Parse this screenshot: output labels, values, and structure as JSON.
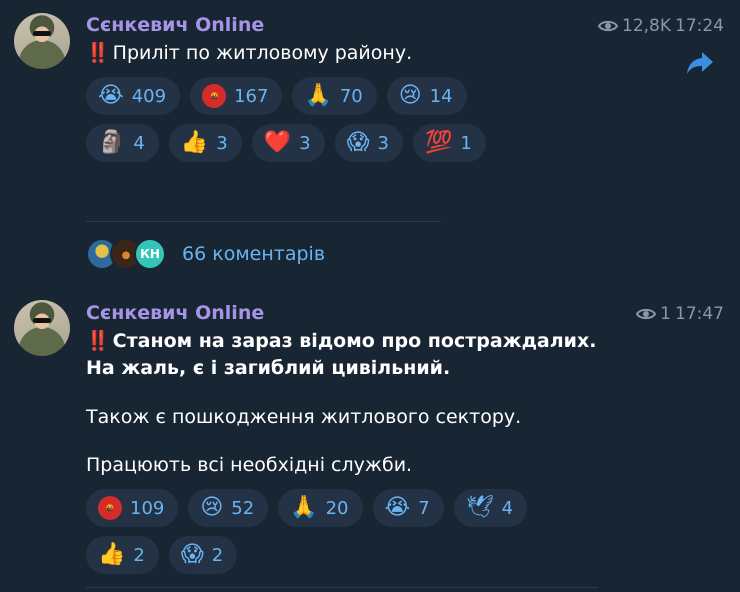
{
  "posts": [
    {
      "author": "Сєнкевич Online",
      "views": "12,8K",
      "time": "17:24",
      "alert": "‼️",
      "text": "Приліт по житловому району.",
      "reactions": [
        {
          "emoji": "😭",
          "count": "409"
        },
        {
          "emoji": "🤬",
          "count": "167"
        },
        {
          "emoji": "🙏",
          "count": "70"
        },
        {
          "emoji": "😢",
          "count": "14"
        },
        {
          "emoji": "🗿",
          "count": "4"
        },
        {
          "emoji": "👍",
          "count": "3"
        },
        {
          "emoji": "❤️",
          "count": "3"
        },
        {
          "emoji": "😱",
          "count": "3"
        },
        {
          "emoji": "💯",
          "count": "1"
        }
      ],
      "comments": {
        "count_label": "66 коментарів",
        "avatar_initials": "КН"
      }
    },
    {
      "author": "Сєнкевич Online",
      "views": "1",
      "time": "17:47",
      "alert": "‼️",
      "text_bold": "Станом на зараз відомо про постраждалих. На жаль, є і загиблий цивільний.",
      "text_line2": "Також є пошкодження житлового сектору.",
      "text_line3": "Працюють всі необхідні служби.",
      "reactions": [
        {
          "emoji": "🤬",
          "count": "109"
        },
        {
          "emoji": "😢",
          "count": "52"
        },
        {
          "emoji": "🙏",
          "count": "20"
        },
        {
          "emoji": "😭",
          "count": "7"
        },
        {
          "emoji": "🕊",
          "count": "4"
        },
        {
          "emoji": "👍",
          "count": "2"
        },
        {
          "emoji": "😱",
          "count": "2"
        }
      ]
    }
  ],
  "icons": {
    "views": "eye-icon",
    "share": "share-arrow-icon"
  },
  "colors": {
    "background": "#182533",
    "author": "#a695e7",
    "accent": "#6ab4f2",
    "reaction_bg": "#233245",
    "meta": "#8a97a6"
  }
}
